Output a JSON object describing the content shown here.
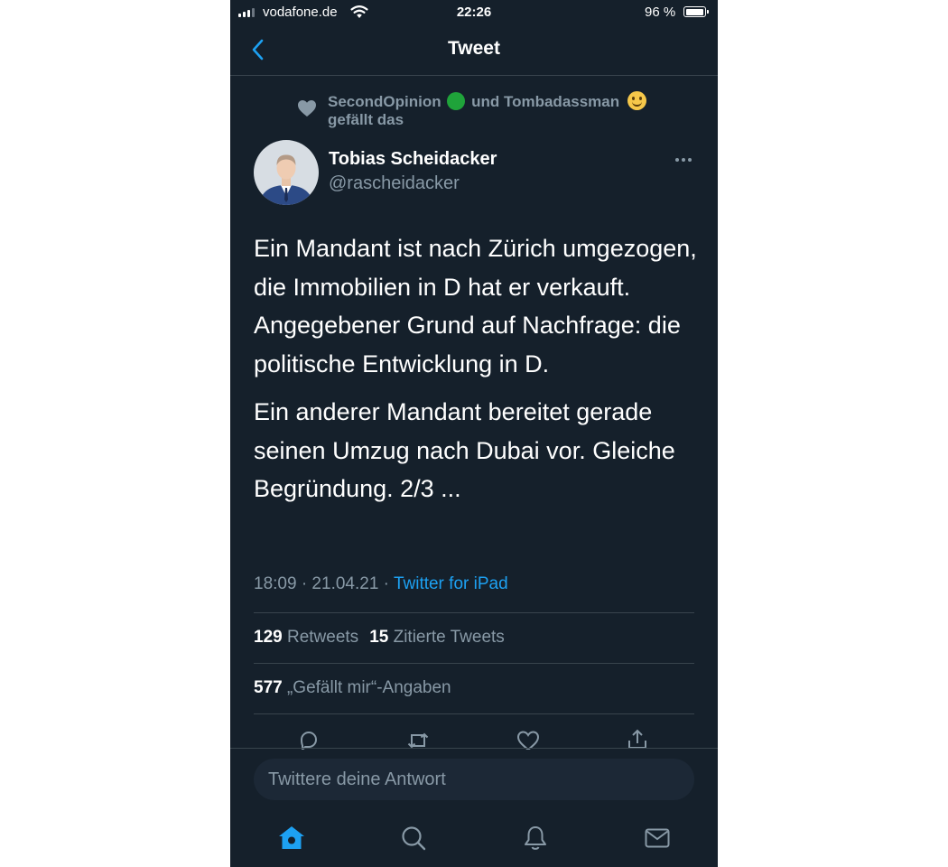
{
  "status_bar": {
    "carrier": "vodafone.de",
    "time": "22:26",
    "battery_percent": "96 %",
    "battery_level": 0.96
  },
  "header": {
    "title": "Tweet",
    "back_icon": "chevron-left-icon"
  },
  "social_context": {
    "user1": "SecondOpinion",
    "conjunction": "und",
    "user2": "Tombadassman",
    "suffix": "gefällt das",
    "user1_emoji_color": "#1fa33a"
  },
  "tweet": {
    "author_name": "Tobias Scheidacker",
    "author_handle": "@rascheidacker",
    "paragraphs": [
      "Ein Mandant ist nach Zürich umgezogen, die Immobilien in D hat er verkauft. Angegebener Grund auf Nachfrage: die politische Entwicklung in D.",
      "Ein anderer Mandant bereitet gerade seinen Umzug nach Dubai vor. Gleiche Begründung. 2/3 ..."
    ],
    "timestamp": "18:09 · 21.04.21 · ",
    "client": "Twitter for iPad"
  },
  "stats": {
    "retweets_count": "129",
    "retweets_label": "Retweets",
    "quotes_count": "15",
    "quotes_label": "Zitierte Tweets",
    "likes_count": "577",
    "likes_label": "„Gefällt mir“-Angaben"
  },
  "actions": [
    "reply-icon",
    "retweet-icon",
    "like-icon",
    "share-icon"
  ],
  "reply_box": {
    "placeholder": "Twittere deine Antwort"
  },
  "tab_bar": [
    "home-icon",
    "search-icon",
    "notifications-icon",
    "messages-icon"
  ],
  "colors": {
    "background": "#15202b",
    "accent": "#1da1f2",
    "secondary_text": "#8899a6",
    "divider": "#38444d"
  }
}
